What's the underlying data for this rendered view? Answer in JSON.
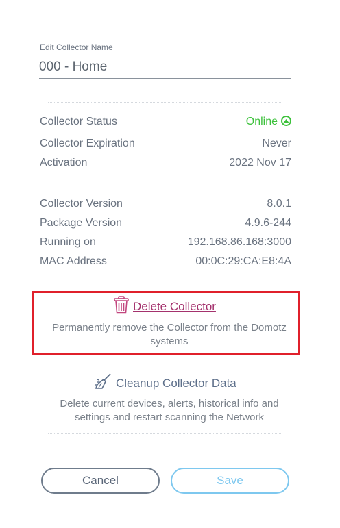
{
  "name_field": {
    "label": "Edit Collector Name",
    "value": "000 - Home"
  },
  "status": {
    "rows": [
      {
        "label": "Collector Status",
        "value": "Online"
      },
      {
        "label": "Collector Expiration",
        "value": "Never"
      },
      {
        "label": "Activation",
        "value": "2022 Nov 17"
      }
    ],
    "online_color": "#3cc13b"
  },
  "info": {
    "rows": [
      {
        "label": "Collector Version",
        "value": "8.0.1"
      },
      {
        "label": "Package Version",
        "value": "4.9.6-244"
      },
      {
        "label": "Running on",
        "value": "192.168.86.168:3000"
      },
      {
        "label": "MAC Address",
        "value": "00:0C:29:CA:E8:4A"
      }
    ]
  },
  "delete_collector": {
    "title": "Delete Collector",
    "description_line1": "Permanently remove the Collector from the Domotz",
    "description_line2": "systems",
    "icon": "trash-icon",
    "color": "#a4326d"
  },
  "cleanup": {
    "title": "Cleanup Collector Data",
    "description_line1": "Delete current devices, alerts, historical info and",
    "description_line2": "settings and restart scanning the Network",
    "icon": "broom-icon"
  },
  "buttons": {
    "cancel": "Cancel",
    "save": "Save"
  }
}
